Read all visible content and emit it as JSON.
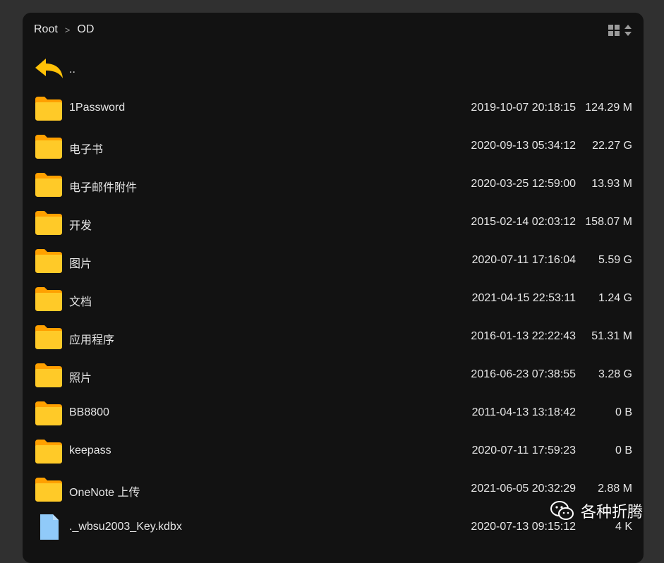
{
  "breadcrumb": {
    "items": [
      "Root",
      "OD"
    ],
    "separator": ">"
  },
  "view_controls": {
    "grid_icon": "grid-view-icon",
    "sort_icon": "sort-icon"
  },
  "parent_entry": {
    "icon": "back-arrow-icon",
    "name": ".."
  },
  "files": [
    {
      "icon": "folder-icon",
      "name": "1Password",
      "date": "2019-10-07 20:18:15",
      "size": "124.29 M"
    },
    {
      "icon": "folder-icon",
      "name": "电子书",
      "date": "2020-09-13 05:34:12",
      "size": "22.27 G"
    },
    {
      "icon": "folder-icon",
      "name": "电子邮件附件",
      "date": "2020-03-25 12:59:00",
      "size": "13.93 M"
    },
    {
      "icon": "folder-icon",
      "name": "开发",
      "date": "2015-02-14 02:03:12",
      "size": "158.07 M"
    },
    {
      "icon": "folder-icon",
      "name": "图片",
      "date": "2020-07-11 17:16:04",
      "size": "5.59 G"
    },
    {
      "icon": "folder-icon",
      "name": "文档",
      "date": "2021-04-15 22:53:11",
      "size": "1.24 G"
    },
    {
      "icon": "folder-icon",
      "name": "应用程序",
      "date": "2016-01-13 22:22:43",
      "size": "51.31 M"
    },
    {
      "icon": "folder-icon",
      "name": "照片",
      "date": "2016-06-23 07:38:55",
      "size": "3.28 G"
    },
    {
      "icon": "folder-icon",
      "name": "BB8800",
      "date": "2011-04-13 13:18:42",
      "size": "0 B"
    },
    {
      "icon": "folder-icon",
      "name": "keepass",
      "date": "2020-07-11 17:59:23",
      "size": "0 B"
    },
    {
      "icon": "folder-icon",
      "name": "OneNote 上传",
      "date": "2021-06-05 20:32:29",
      "size": "2.88 M"
    },
    {
      "icon": "file-icon",
      "name": "._wbsu2003_Key.kdbx",
      "date": "2020-07-13 09:15:12",
      "size": "4 K"
    }
  ],
  "watermark": {
    "icon": "wechat-icon",
    "text": "各种折腾"
  },
  "colors": {
    "background": "#303030",
    "panel": "#121212",
    "folder": "#FFC107",
    "file": "#90CAF9",
    "text": "#e6e6e6"
  }
}
